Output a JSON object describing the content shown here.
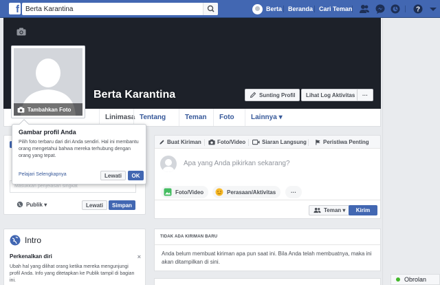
{
  "topbar": {
    "search_value": "Berta Karantina",
    "user_name": "Berta",
    "home_label": "Beranda",
    "find_friends_label": "Cari Teman"
  },
  "profile": {
    "name": "Berta Karantina",
    "add_photo_label": "Tambahkan Foto",
    "edit_profile_label": "Sunting Profil",
    "activity_log_label": "Lihat Log Aktivitas",
    "more_label": "···"
  },
  "profile_nav": {
    "items": [
      {
        "label": "Linimasa"
      },
      {
        "label": "Tentang"
      },
      {
        "label": "Teman"
      },
      {
        "label": "Foto"
      },
      {
        "label": "Lainnya ▾"
      }
    ]
  },
  "popup": {
    "title": "Gambar profil Anda",
    "text": "Pilih foto terbaru dari diri Anda sendiri. Hal ini membantu orang mengetahui bahwa mereka terhubung dengan orang yang tepat.",
    "link": "Pelajari Selengkapnya",
    "skip_label": "Lewati",
    "ok_label": "OK"
  },
  "bio": {
    "placeholder": "Masukkan penjelasan singkat",
    "privacy_label": "Publik ▾",
    "skip_label": "Lewati",
    "save_label": "Simpan"
  },
  "intro": {
    "title": "Intro",
    "subtitle": "Perkenalkan diri",
    "text": "Ubah hal yang dilihat orang ketika mereka mengunjungi profil Anda. Info yang ditetapkan ke Publik tampil di bagian ini.",
    "close": "×"
  },
  "composer": {
    "tabs": [
      {
        "label": "Buat Kiriman"
      },
      {
        "label": "Foto/Video"
      },
      {
        "label": "Siaran Langsung"
      },
      {
        "label": "Peristiwa Penting"
      }
    ],
    "placeholder": "Apa yang Anda pikirkan sekarang?",
    "photo_label": "Foto/Video",
    "feeling_label": "Perasaan/Aktivitas",
    "more_label": "···",
    "audience_label": "Teman ▾",
    "post_label": "Kirim"
  },
  "feed": {
    "header": "TIDAK ADA KIRIMAN BARU",
    "message": "Anda belum membuat kiriman apa pun saat ini. Bila Anda telah membuatnya, maka ini akan ditampilkan di sini."
  },
  "chat": {
    "label": "Obrolan"
  },
  "colors": {
    "brand": "#4267b2",
    "link": "#365899",
    "online": "#42b72a"
  }
}
